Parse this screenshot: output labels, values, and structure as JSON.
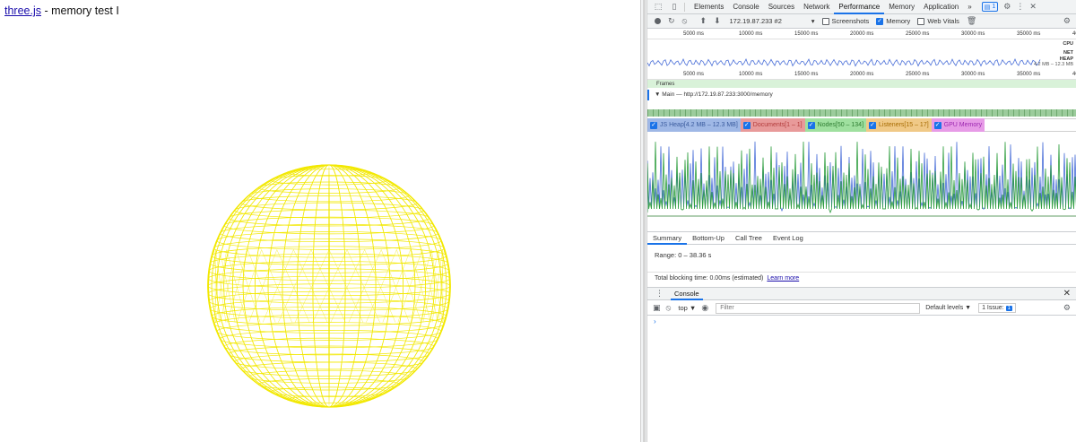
{
  "page": {
    "link_text": "three.js",
    "title_suffix": " - memory test I",
    "sphere_color": "#f2e800"
  },
  "devtools": {
    "tabs": [
      "Elements",
      "Console",
      "Sources",
      "Network",
      "Performance",
      "Memory",
      "Application"
    ],
    "active_tab": "Performance",
    "more_tabs": "»",
    "issues_badge_count": "1",
    "url_select": "172.19.87.233 #2",
    "screenshots_label": "Screenshots",
    "memory_label": "Memory",
    "web_vitals_label": "Web Vitals",
    "ruler_top": [
      "5000 ms",
      "10000 ms",
      "15000 ms",
      "20000 ms",
      "25000 ms",
      "30000 ms",
      "35000 ms",
      "40"
    ],
    "ruler_bottom": [
      "5000 ms",
      "10000 ms",
      "15000 ms",
      "20000 ms",
      "25000 ms",
      "30000 ms",
      "35000 ms",
      "4000"
    ],
    "cpu_label": "CPU",
    "net_label": "NET",
    "heap_label": "HEAP",
    "heap_range": "4.2 MB – 12.3 MB",
    "frames_label": "Frames",
    "main_label": "▼ Main — http://172.19.87.233:3000/memory",
    "counters": [
      {
        "label": "JS Heap[4.2 MB – 12.3 MB]",
        "bg": "#9fb8e6",
        "color": "#3b5c9e"
      },
      {
        "label": "Documents[1 – 1]",
        "bg": "#e89a9a",
        "color": "#b23b3b"
      },
      {
        "label": "Nodes[50 – 134]",
        "bg": "#9fe09f",
        "color": "#2e7d32"
      },
      {
        "label": "Listeners[15 – 17]",
        "bg": "#f0c987",
        "color": "#a66a00"
      },
      {
        "label": "GPU Memory",
        "bg": "#e79be7",
        "color": "#9c27b0"
      }
    ],
    "bottom_tabs": [
      "Summary",
      "Bottom-Up",
      "Call Tree",
      "Event Log"
    ],
    "active_bottom_tab": "Summary",
    "range_text": "Range: 0 – 38.36 s",
    "tbt_text": "Total blocking time: 0.00ms (estimated)",
    "learn_more": "Learn more",
    "drawer_tab": "Console",
    "console_context": "top ▼",
    "filter_placeholder": "Filter",
    "default_levels": "Default levels ▼",
    "issues_label": "1 Issue:",
    "issues_count": "1",
    "prompt_symbol": "›"
  }
}
